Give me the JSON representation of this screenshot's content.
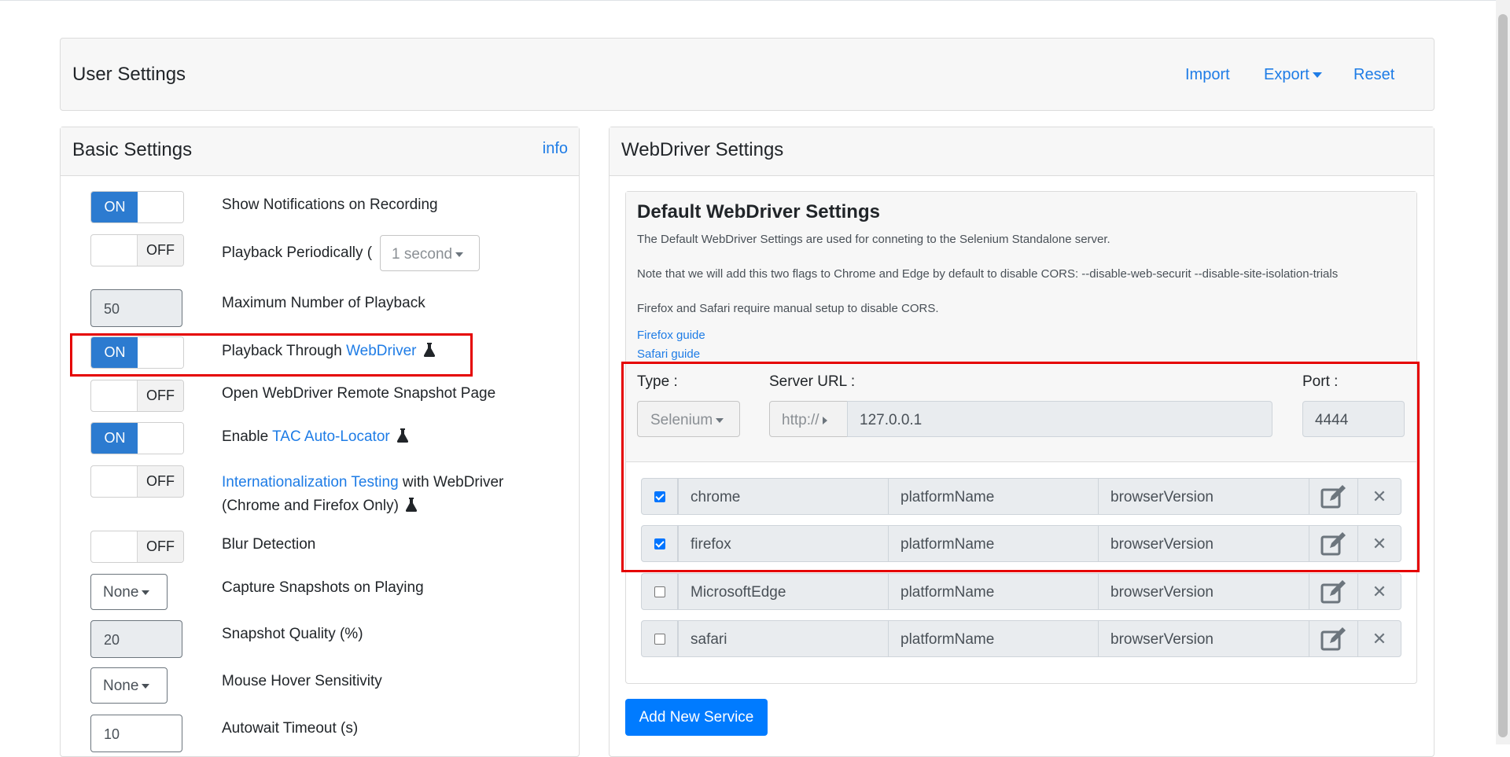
{
  "header": {
    "title": "User Settings",
    "import_label": "Import",
    "export_label": "Export",
    "reset_label": "Reset"
  },
  "basic": {
    "title": "Basic Settings",
    "info_label": "info",
    "on_label": "ON",
    "off_label": "OFF",
    "items": {
      "notifications": "Show Notifications on Recording",
      "periodic_prefix": "Playback Periodically (",
      "periodic_value": "1 second",
      "periodic_suffix": ")",
      "max_playback_label": "Maximum Number of Playback",
      "max_playback_value": "50",
      "webdriver_prefix": "Playback Through ",
      "webdriver_link": "WebDriver",
      "snapshot_page": "Open WebDriver Remote Snapshot Page",
      "tac_prefix": "Enable ",
      "tac_link": "TAC Auto-Locator",
      "i18n_link": "Internationalization Testing",
      "i18n_rest": " with WebDriver",
      "i18n_line2": "(Chrome and Firefox Only)",
      "blur": "Blur Detection",
      "capture_label": "Capture Snapshots on Playing",
      "capture_value": "None",
      "quality_label": "Snapshot Quality (%)",
      "quality_value": "20",
      "hover_label": "Mouse Hover Sensitivity",
      "hover_value": "None",
      "autowait_label": "Autowait Timeout (s)",
      "autowait_value": "10"
    }
  },
  "webdriver": {
    "title": "WebDriver Settings",
    "default_title": "Default WebDriver Settings",
    "desc1": "The Default WebDriver Settings are used for conneting to the Selenium Standalone server.",
    "desc2": "Note that we will add this two flags to Chrome and Edge by default to disable CORS: --disable-web-securit --disable-site-isolation-trials",
    "desc3": "Firefox and Safari require manual setup to disable CORS.",
    "firefox_guide": "Firefox guide",
    "safari_guide": "Safari guide",
    "type_label": "Type :",
    "type_value": "Selenium",
    "server_label": "Server URL :",
    "protocol_value": "http://",
    "server_value": "127.0.0.1",
    "port_label": "Port :",
    "port_value": "4444",
    "services": [
      {
        "browser": "chrome",
        "platform": "platformName",
        "version": "browserVersion"
      },
      {
        "browser": "firefox",
        "platform": "platformName",
        "version": "browserVersion"
      },
      {
        "browser": "MicrosoftEdge",
        "platform": "platformName",
        "version": "browserVersion"
      },
      {
        "browser": "safari",
        "platform": "platformName",
        "version": "browserVersion"
      }
    ],
    "add_service_label": "Add New Service"
  }
}
